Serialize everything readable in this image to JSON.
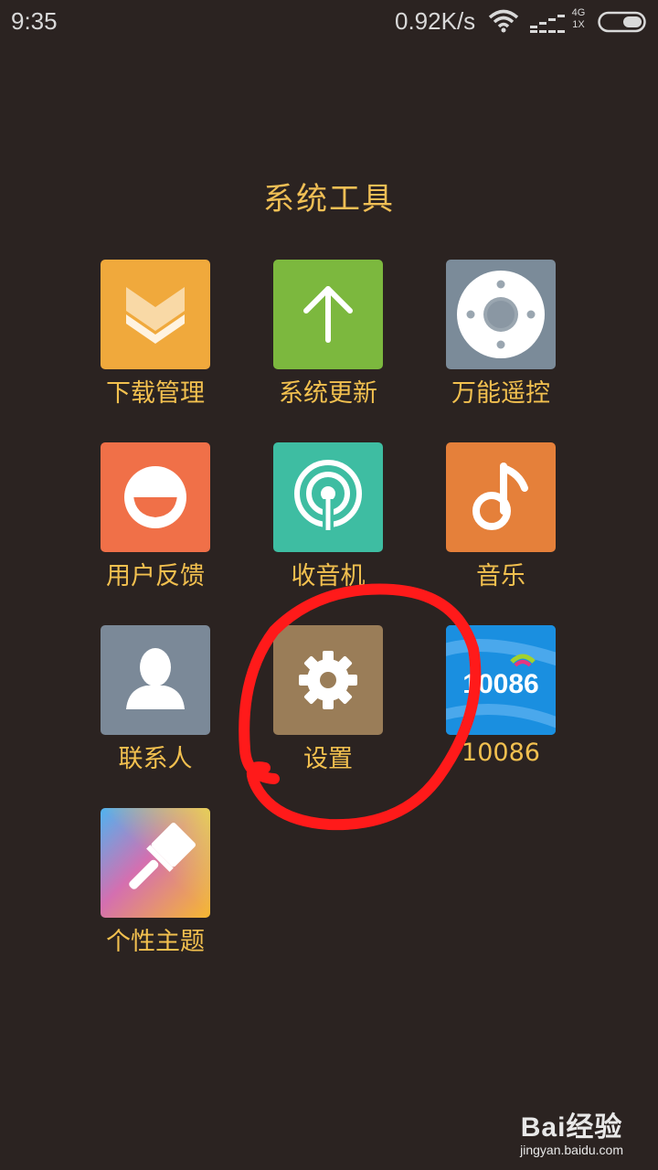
{
  "status_bar": {
    "time": "9:35",
    "net_speed": "0.92K/s",
    "network_top": "4G",
    "network_bottom": "1X"
  },
  "folder": {
    "title": "系统工具",
    "apps": [
      {
        "label": "下载管理",
        "icon": "download-icon",
        "color": "#f0a93c"
      },
      {
        "label": "系统更新",
        "icon": "arrow-up-icon",
        "color": "#7cb83e"
      },
      {
        "label": "万能遥控",
        "icon": "remote-control-icon",
        "color": "#7b8b99"
      },
      {
        "label": "用户反馈",
        "icon": "smiley-face-icon",
        "color": "#f07048"
      },
      {
        "label": "收音机",
        "icon": "radio-broadcast-icon",
        "color": "#3ebda2"
      },
      {
        "label": "音乐",
        "icon": "music-note-icon",
        "color": "#e5803a"
      },
      {
        "label": "联系人",
        "icon": "contact-person-icon",
        "color": "#7b8998"
      },
      {
        "label": "设置",
        "icon": "gear-icon",
        "color": "#9a7d58"
      },
      {
        "label": "10086",
        "icon": "china-mobile-10086-icon",
        "color": "#1a8fe0"
      },
      {
        "label": "个性主题",
        "icon": "paint-brush-icon",
        "color": "#e06aa0"
      }
    ]
  },
  "overlay": {
    "annotation_color": "#ff1a1a",
    "annotation": "red-hand-drawn-circle"
  },
  "watermark": {
    "logo": "Bai经验",
    "url": "jingyan.baidu.com"
  }
}
